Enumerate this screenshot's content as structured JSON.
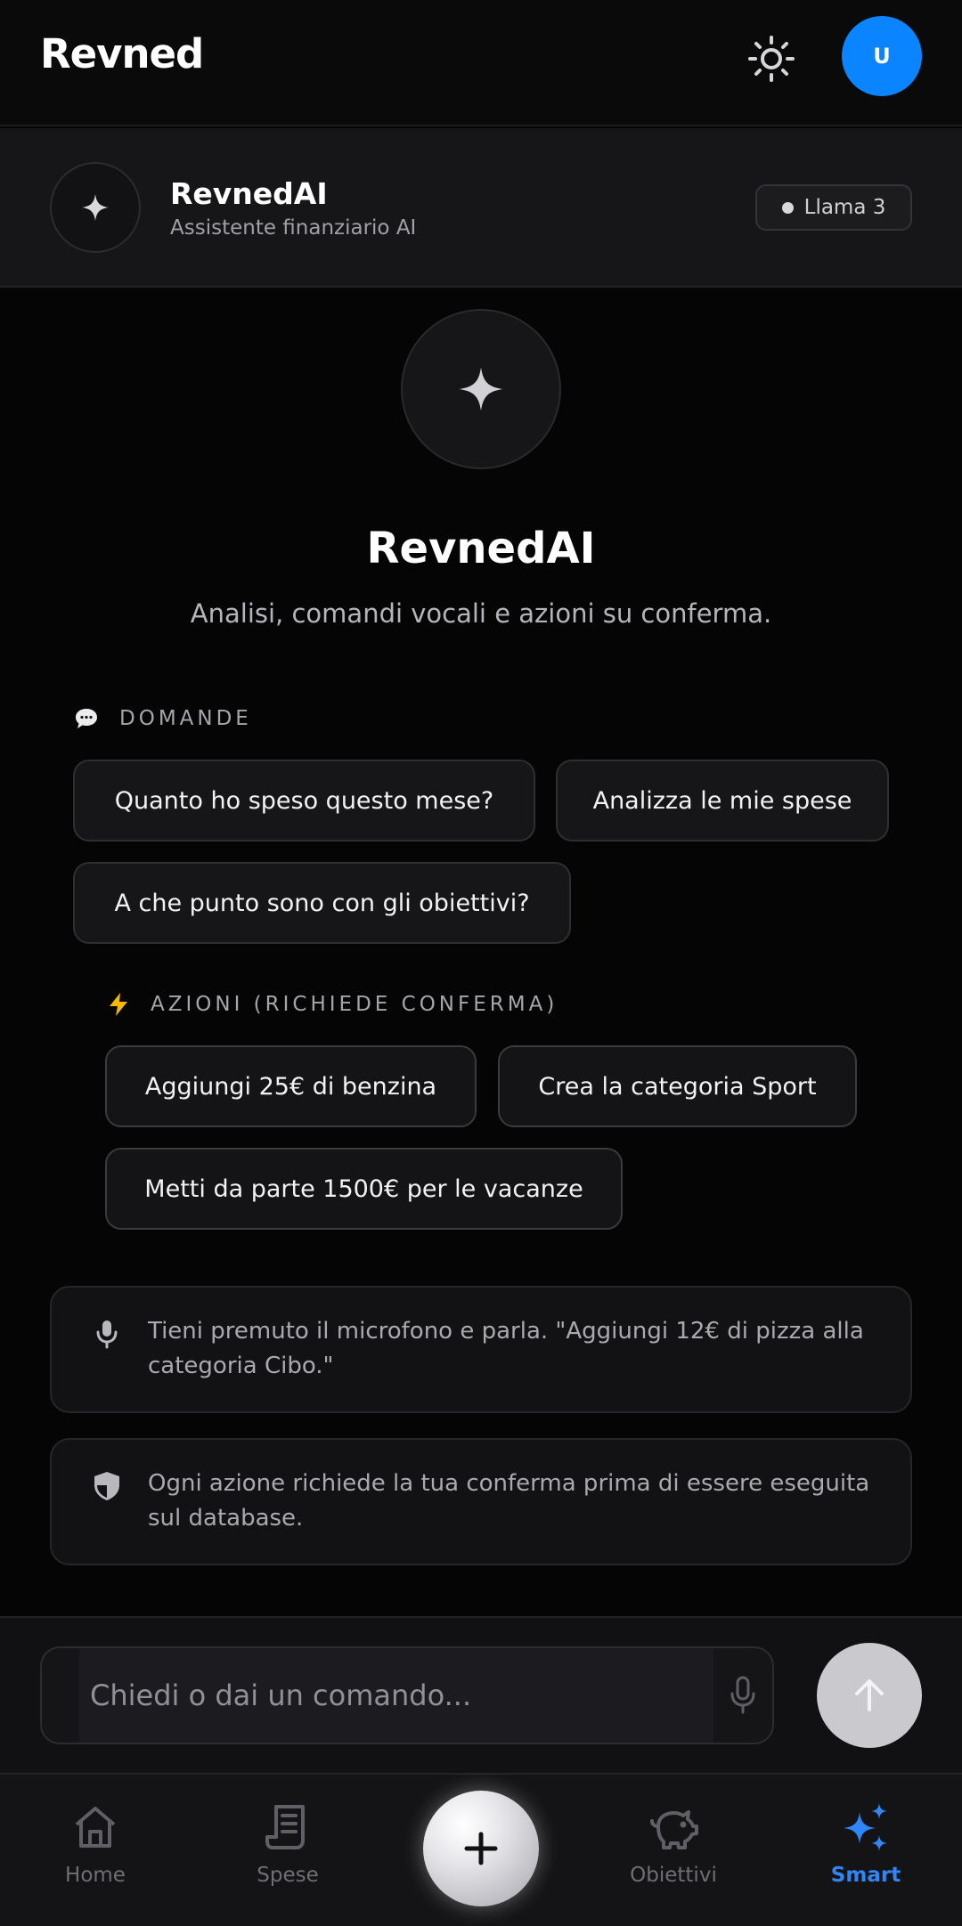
{
  "header": {
    "brand": "Revned",
    "avatar_initial": "U"
  },
  "assistant": {
    "name": "RevnedAI",
    "subtitle": "Assistente finanziario AI",
    "model": "Llama 3"
  },
  "hero": {
    "title": "RevnedAI",
    "subtitle": "Analisi, comandi vocali e azioni su conferma."
  },
  "questions": {
    "label": "DOMANDE",
    "chips": [
      "Quanto ho speso questo mese?",
      "Analizza le mie spese",
      "A che punto sono con gli obiettivi?"
    ]
  },
  "actions": {
    "label": "AZIONI (RICHIEDE CONFERMA)",
    "chips": [
      "Aggiungi 25€ di benzina",
      "Crea la categoria Sport",
      "Metti da parte 1500€ per le vacanze"
    ]
  },
  "info": {
    "voice": "Tieni premuto il microfono e parla. \"Aggiungi 12€ di pizza alla categoria Cibo.\"",
    "confirm": "Ogni azione richiede la tua conferma prima di essere eseguita sul database."
  },
  "composer": {
    "placeholder": "Chiedi o dai un comando..."
  },
  "nav": {
    "home": "Home",
    "spese": "Spese",
    "obiettivi": "Obiettivi",
    "smart": "Smart"
  },
  "colors": {
    "accent": "#0a84ff",
    "active_nav": "#2f86f6"
  }
}
